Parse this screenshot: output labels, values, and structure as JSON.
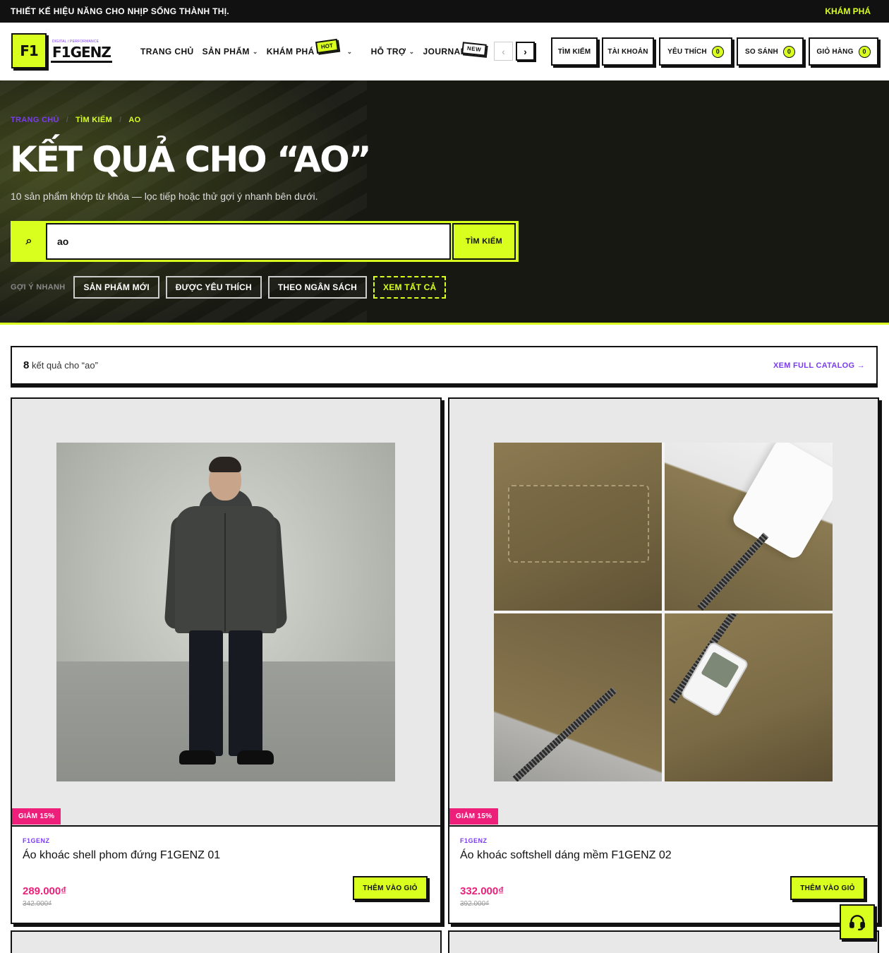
{
  "topbar": {
    "promo": "THIẾT KẾ HIỆU NĂNG CHO NHỊP SỐNG THÀNH THỊ.",
    "explore": "KHÁM PHÁ"
  },
  "logo": {
    "mark": "F1",
    "tagline": "DIGITAL / PERFORMANCE",
    "wordmark": "F1GENZ"
  },
  "nav": {
    "items": [
      {
        "label": "TRANG CHỦ",
        "dropdown": false
      },
      {
        "label": "SẢN PHẨM",
        "dropdown": true
      },
      {
        "label": "KHÁM PHÁ",
        "dropdown": false
      },
      {
        "label": "HỖ TRỢ",
        "dropdown": true
      },
      {
        "label": "JOURNAL",
        "dropdown": false
      }
    ],
    "hot_badge": "HOT",
    "new_badge": "NEW"
  },
  "header_actions": {
    "search": "TÌM KIẾM",
    "account": "TÀI KHOẢN",
    "wishlist": "YÊU THÍCH",
    "wishlist_count": "0",
    "compare": "SO SÁNH",
    "compare_count": "0",
    "cart": "GIỎ HÀNG",
    "cart_count": "0"
  },
  "hero": {
    "breadcrumb": [
      "TRANG CHỦ",
      "TÌM KIẾM",
      "AO"
    ],
    "breadcrumb_sep": "/",
    "title": "KẾT QUẢ CHO “AO”",
    "subtitle": "10 sản phẩm khớp từ khóa — lọc tiếp hoặc thử gợi ý nhanh bên dưới.",
    "search_value": "ao",
    "search_button": "TÌM KIẾM",
    "quick_label": "GỢI Ý NHANH",
    "chips": [
      "SẢN PHẨM MỚI",
      "ĐƯỢC YÊU THÍCH",
      "THEO NGÂN SÁCH",
      "XEM TẤT CẢ"
    ]
  },
  "results": {
    "count": "8",
    "text": "kết quả cho “ao”",
    "catalog_link": "XEM FULL CATALOG →"
  },
  "products": [
    {
      "discount": "GIẢM 15%",
      "brand": "F1GENZ",
      "name": "Áo khoác shell phom đứng F1GENZ 01",
      "price": "289.000₫",
      "old_price": "342.000₫",
      "button": "THÊM VÀO GIỎ"
    },
    {
      "discount": "GIẢM 15%",
      "brand": "F1GENZ",
      "name": "Áo khoác softshell dáng mềm F1GENZ 02",
      "price": "332.000₫",
      "old_price": "392.000₫",
      "button": "THÊM VÀO GIỎ"
    }
  ],
  "colors": {
    "accent": "#d9ff1f",
    "purple": "#7a3cf0",
    "sale": "#ee1f7a",
    "dark": "#111111"
  }
}
